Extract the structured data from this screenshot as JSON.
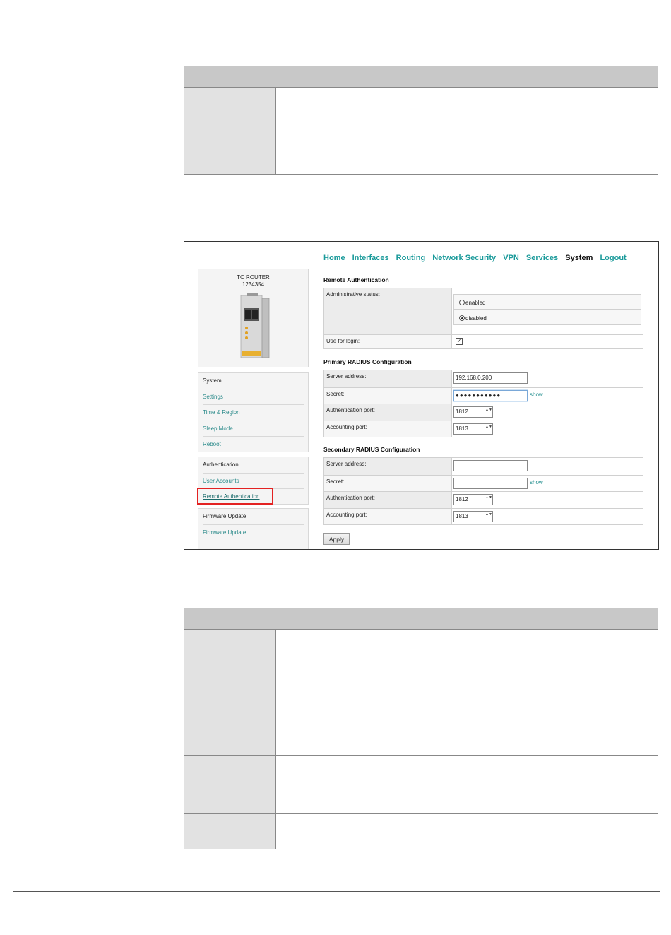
{
  "nav": {
    "items": [
      "Home",
      "Interfaces",
      "Routing",
      "Network Security",
      "VPN",
      "Services",
      "System",
      "Logout"
    ],
    "current": "System"
  },
  "device": {
    "name_line1": "TC ROUTER",
    "name_line2": "1234354"
  },
  "sidebar": {
    "system": {
      "title": "System",
      "items": [
        "Settings",
        "Time & Region",
        "Sleep Mode",
        "Reboot"
      ]
    },
    "authentication": {
      "title": "Authentication",
      "items": [
        "User Accounts",
        "Remote Authentication"
      ]
    },
    "firmware": {
      "title": "Firmware Update",
      "items": [
        "Firmware Update"
      ]
    }
  },
  "remote_auth": {
    "title": "Remote Authentication",
    "admin_status_label": "Administrative status:",
    "enabled_label": "enabled",
    "disabled_label": "disabled",
    "selected": "disabled",
    "use_for_login_label": "Use for login:",
    "use_for_login_checked": true,
    "check_mark": "✓"
  },
  "primary": {
    "title": "Primary RADIUS Configuration",
    "server_label": "Server address:",
    "server_value": "192.168.0.200",
    "secret_label": "Secret:",
    "secret_value": "●●●●●●●●●●●",
    "show_label": "show",
    "auth_port_label": "Authentication port:",
    "auth_port_value": "1812",
    "acct_port_label": "Accounting port:",
    "acct_port_value": "1813"
  },
  "secondary": {
    "title": "Secondary RADIUS Configuration",
    "server_label": "Server address:",
    "server_value": "",
    "secret_label": "Secret:",
    "secret_value": "",
    "show_label": "show",
    "auth_port_label": "Authentication port:",
    "auth_port_value": "1812",
    "acct_port_label": "Accounting port:",
    "acct_port_value": "1813"
  },
  "apply_label": "Apply",
  "spin_arrows": "▲▼"
}
